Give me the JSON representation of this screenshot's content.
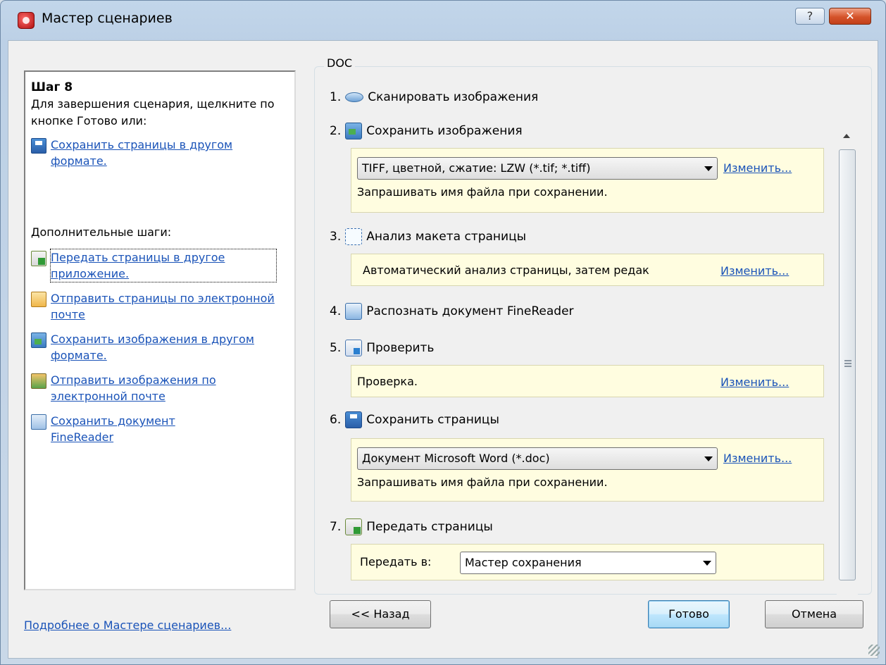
{
  "window": {
    "title": "Мастер сценариев",
    "help_label": "?",
    "close_label": "✕"
  },
  "left_panel": {
    "step_title": "Шаг 8",
    "step_desc": "Для завершения сценария, щелкните по кнопке Готово или:",
    "save_pages_other_format": "Сохранить страницы в другом формате.",
    "extra_steps_label": "Дополнительные шаги:",
    "extra_links": [
      {
        "label": "Передать страницы в другое приложение.",
        "icon": "pages-transfer-icon"
      },
      {
        "label": "Отправить страницы по электронной почте",
        "icon": "pages-mail-icon"
      },
      {
        "label": "Сохранить изображения в другом формате.",
        "icon": "save-image-icon"
      },
      {
        "label": "Отправить изображения по электронной почте",
        "icon": "image-mail-icon"
      },
      {
        "label": "Сохранить документ FineReader",
        "icon": "finereader-doc-icon"
      }
    ]
  },
  "more_link": "Подробнее о Мастере сценариев...",
  "group": {
    "label": "DOC",
    "steps": [
      {
        "num": "1.",
        "label": "Сканировать изображения"
      },
      {
        "num": "2.",
        "label": "Сохранить изображения"
      },
      {
        "num": "3.",
        "label": "Анализ макета страницы"
      },
      {
        "num": "4.",
        "label": "Распознать документ FineReader"
      },
      {
        "num": "5.",
        "label": "Проверить"
      },
      {
        "num": "6.",
        "label": "Сохранить страницы"
      },
      {
        "num": "7.",
        "label": "Передать страницы"
      }
    ],
    "save_images_format": "TIFF, цветной, сжатие: LZW (*.tif; *.tiff)",
    "save_images_ask": "Запрашивать имя файла при сохранении.",
    "layout_text": "Автоматический анализ страницы, затем редак",
    "check_text": "Проверка.",
    "save_pages_format": "Документ Microsoft Word (*.doc)",
    "save_pages_ask": "Запрашивать имя файла при сохранении.",
    "transfer_label": "Передать в:",
    "transfer_value": "Мастер сохранения",
    "change_link": "Изменить..."
  },
  "buttons": {
    "back": "<< Назад",
    "finish": "Готово",
    "cancel": "Отмена"
  }
}
